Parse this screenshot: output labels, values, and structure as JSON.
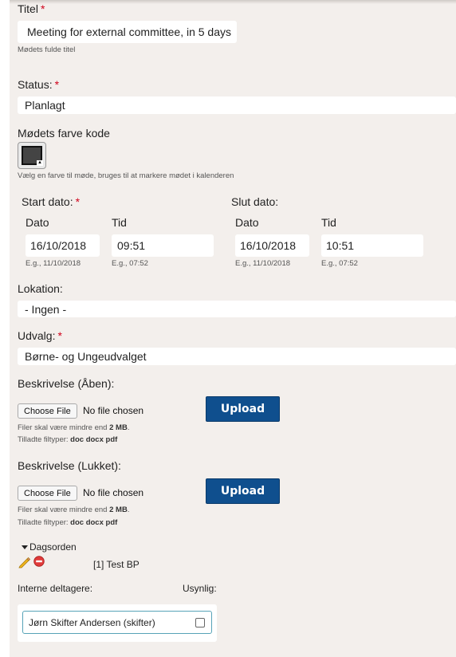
{
  "title_field": {
    "label": "Titel",
    "required_mark": "*",
    "value": "Meeting for external committee, in 5 days",
    "hint": "Mødets fulde titel"
  },
  "status_field": {
    "label": "Status:",
    "required_mark": "*",
    "value": "Planlagt"
  },
  "color_field": {
    "label": "Mødets farve kode",
    "hint": "Vælg en farve til møde, bruges til at markere mødet i kalenderen",
    "color": "#444444"
  },
  "start": {
    "label": "Start dato:",
    "required_mark": "*",
    "date_label": "Dato",
    "time_label": "Tid",
    "date_value": "16/10/2018",
    "time_value": "09:51",
    "date_hint": "E.g., 11/10/2018",
    "time_hint": "E.g., 07:52"
  },
  "end": {
    "label": "Slut dato:",
    "date_label": "Dato",
    "time_label": "Tid",
    "date_value": "16/10/2018",
    "time_value": "10:51",
    "date_hint": "E.g., 11/10/2018",
    "time_hint": "E.g., 07:52"
  },
  "location_field": {
    "label": "Lokation:",
    "value": "- Ingen -"
  },
  "committee_field": {
    "label": "Udvalg:",
    "required_mark": "*",
    "value": "Børne- og Ungeudvalget"
  },
  "desc_open": {
    "label": "Beskrivelse (Åben):",
    "choose_label": "Choose File",
    "no_file": "No file chosen",
    "upload_label": "Upload",
    "size_hint_prefix": "Filer skal være mindre end",
    "size_hint_value": "2 MB",
    "size_hint_suffix": ".",
    "types_prefix": "Tilladte filtyper:",
    "types_value": "doc docx pdf"
  },
  "desc_closed": {
    "label": "Beskrivelse (Lukket):",
    "choose_label": "Choose File",
    "no_file": "No file chosen",
    "upload_label": "Upload",
    "size_hint_prefix": "Filer skal være mindre end",
    "size_hint_value": "2 MB",
    "size_hint_suffix": ".",
    "types_prefix": "Tilladte filtyper:",
    "types_value": "doc docx pdf"
  },
  "agenda": {
    "label": "Dagsorden",
    "item": "[1] Test BP",
    "edit_icon": "pencil-icon",
    "remove_icon": "remove-icon"
  },
  "participants": {
    "internal_label": "Interne deltagere:",
    "invisible_label": "Usynlig:",
    "items": [
      {
        "name": "Jørn Skifter Andersen (skifter)",
        "checked": false
      }
    ]
  },
  "colors": {
    "panel_bg": "#f3efec",
    "required": "#d0021b",
    "upload_button": "#0f4f8e",
    "participant_border": "#57a3b7"
  }
}
